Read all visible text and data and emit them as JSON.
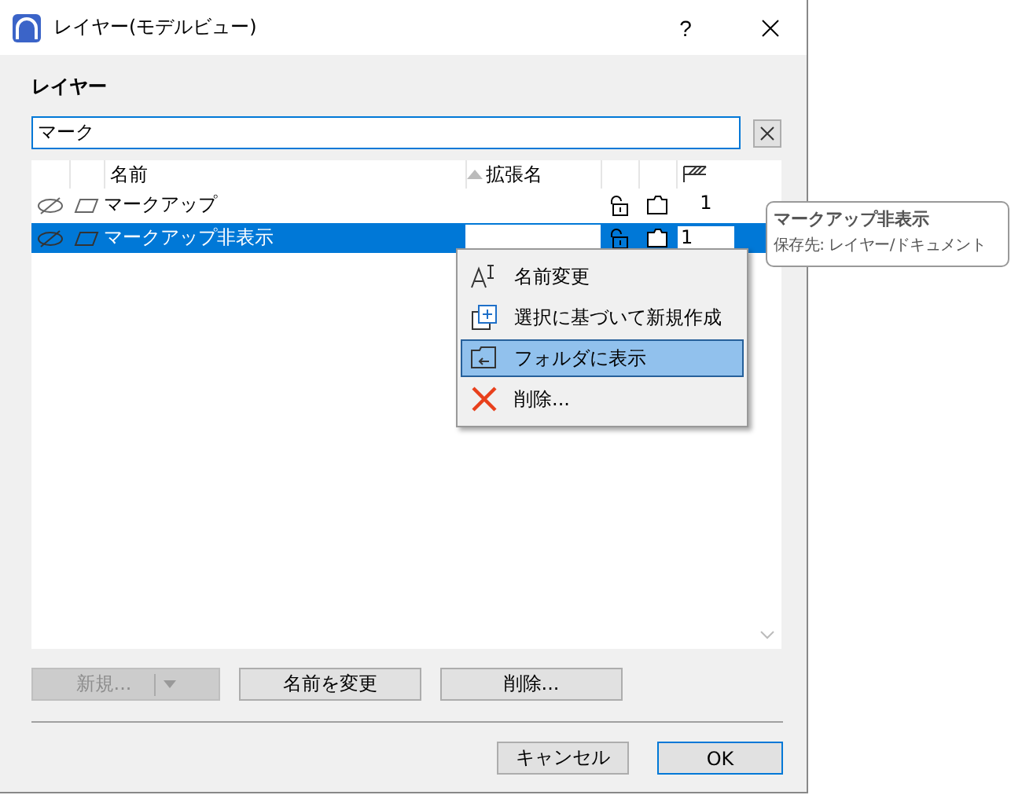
{
  "window": {
    "title": "レイヤー(モデルビュー)",
    "help": "?"
  },
  "section_label": "レイヤー",
  "search": {
    "value": "マーク"
  },
  "table": {
    "columns": [
      "名前",
      "拡張名"
    ],
    "rows": [
      {
        "name": "マークアップ",
        "number": "1",
        "selected": false
      },
      {
        "name": "マークアップ非表示",
        "number": "1",
        "selected": true
      }
    ]
  },
  "context_menu": [
    {
      "kind": "rename",
      "label": "名前変更",
      "selected": false
    },
    {
      "kind": "new",
      "label": "選択に基づいて新規作成",
      "selected": false
    },
    {
      "kind": "folder",
      "label": "フォルダに表示",
      "selected": true
    },
    {
      "kind": "delete",
      "label": "削除...",
      "selected": false
    }
  ],
  "tooltip": {
    "title": "マークアップ非表示",
    "detail": "保存先: レイヤー/ドキュメント"
  },
  "actions": [
    {
      "label": "新規...",
      "disabled": true
    },
    {
      "label": "名前を変更",
      "disabled": false
    },
    {
      "label": "削除...",
      "disabled": false
    }
  ],
  "footer": {
    "cancel": "キャンセル",
    "ok": "OK"
  }
}
